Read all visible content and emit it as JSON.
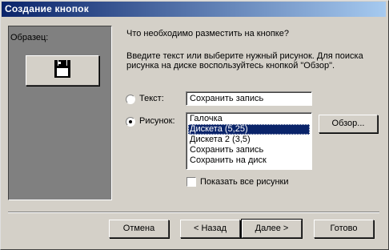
{
  "window": {
    "title": "Создание кнопок"
  },
  "sample": {
    "label": "Образец:"
  },
  "question": "Что необходимо разместить на кнопке?",
  "instructions": [
    "Введите текст или выберите нужный рисунок.  Для поиска",
    "рисунка на диске воспользуйтесь кнопкой \"Обзор\"."
  ],
  "text_option": {
    "label": "Текст:",
    "value": "Сохранить запись",
    "selected": false
  },
  "picture_option": {
    "label": "Рисунок:",
    "selected": true
  },
  "picture_list": {
    "items": [
      "Галочка",
      "Дискета (5,25)",
      "Дискета 2 (3,5)",
      "Сохранить запись",
      "Сохранить на диск"
    ],
    "selected_index": 1
  },
  "browse_button": "Обзор...",
  "show_all_checkbox": {
    "label": "Показать все рисунки",
    "checked": false
  },
  "buttons": {
    "cancel": "Отмена",
    "back": "< Назад",
    "next": "Далее >",
    "finish": "Готово"
  }
}
